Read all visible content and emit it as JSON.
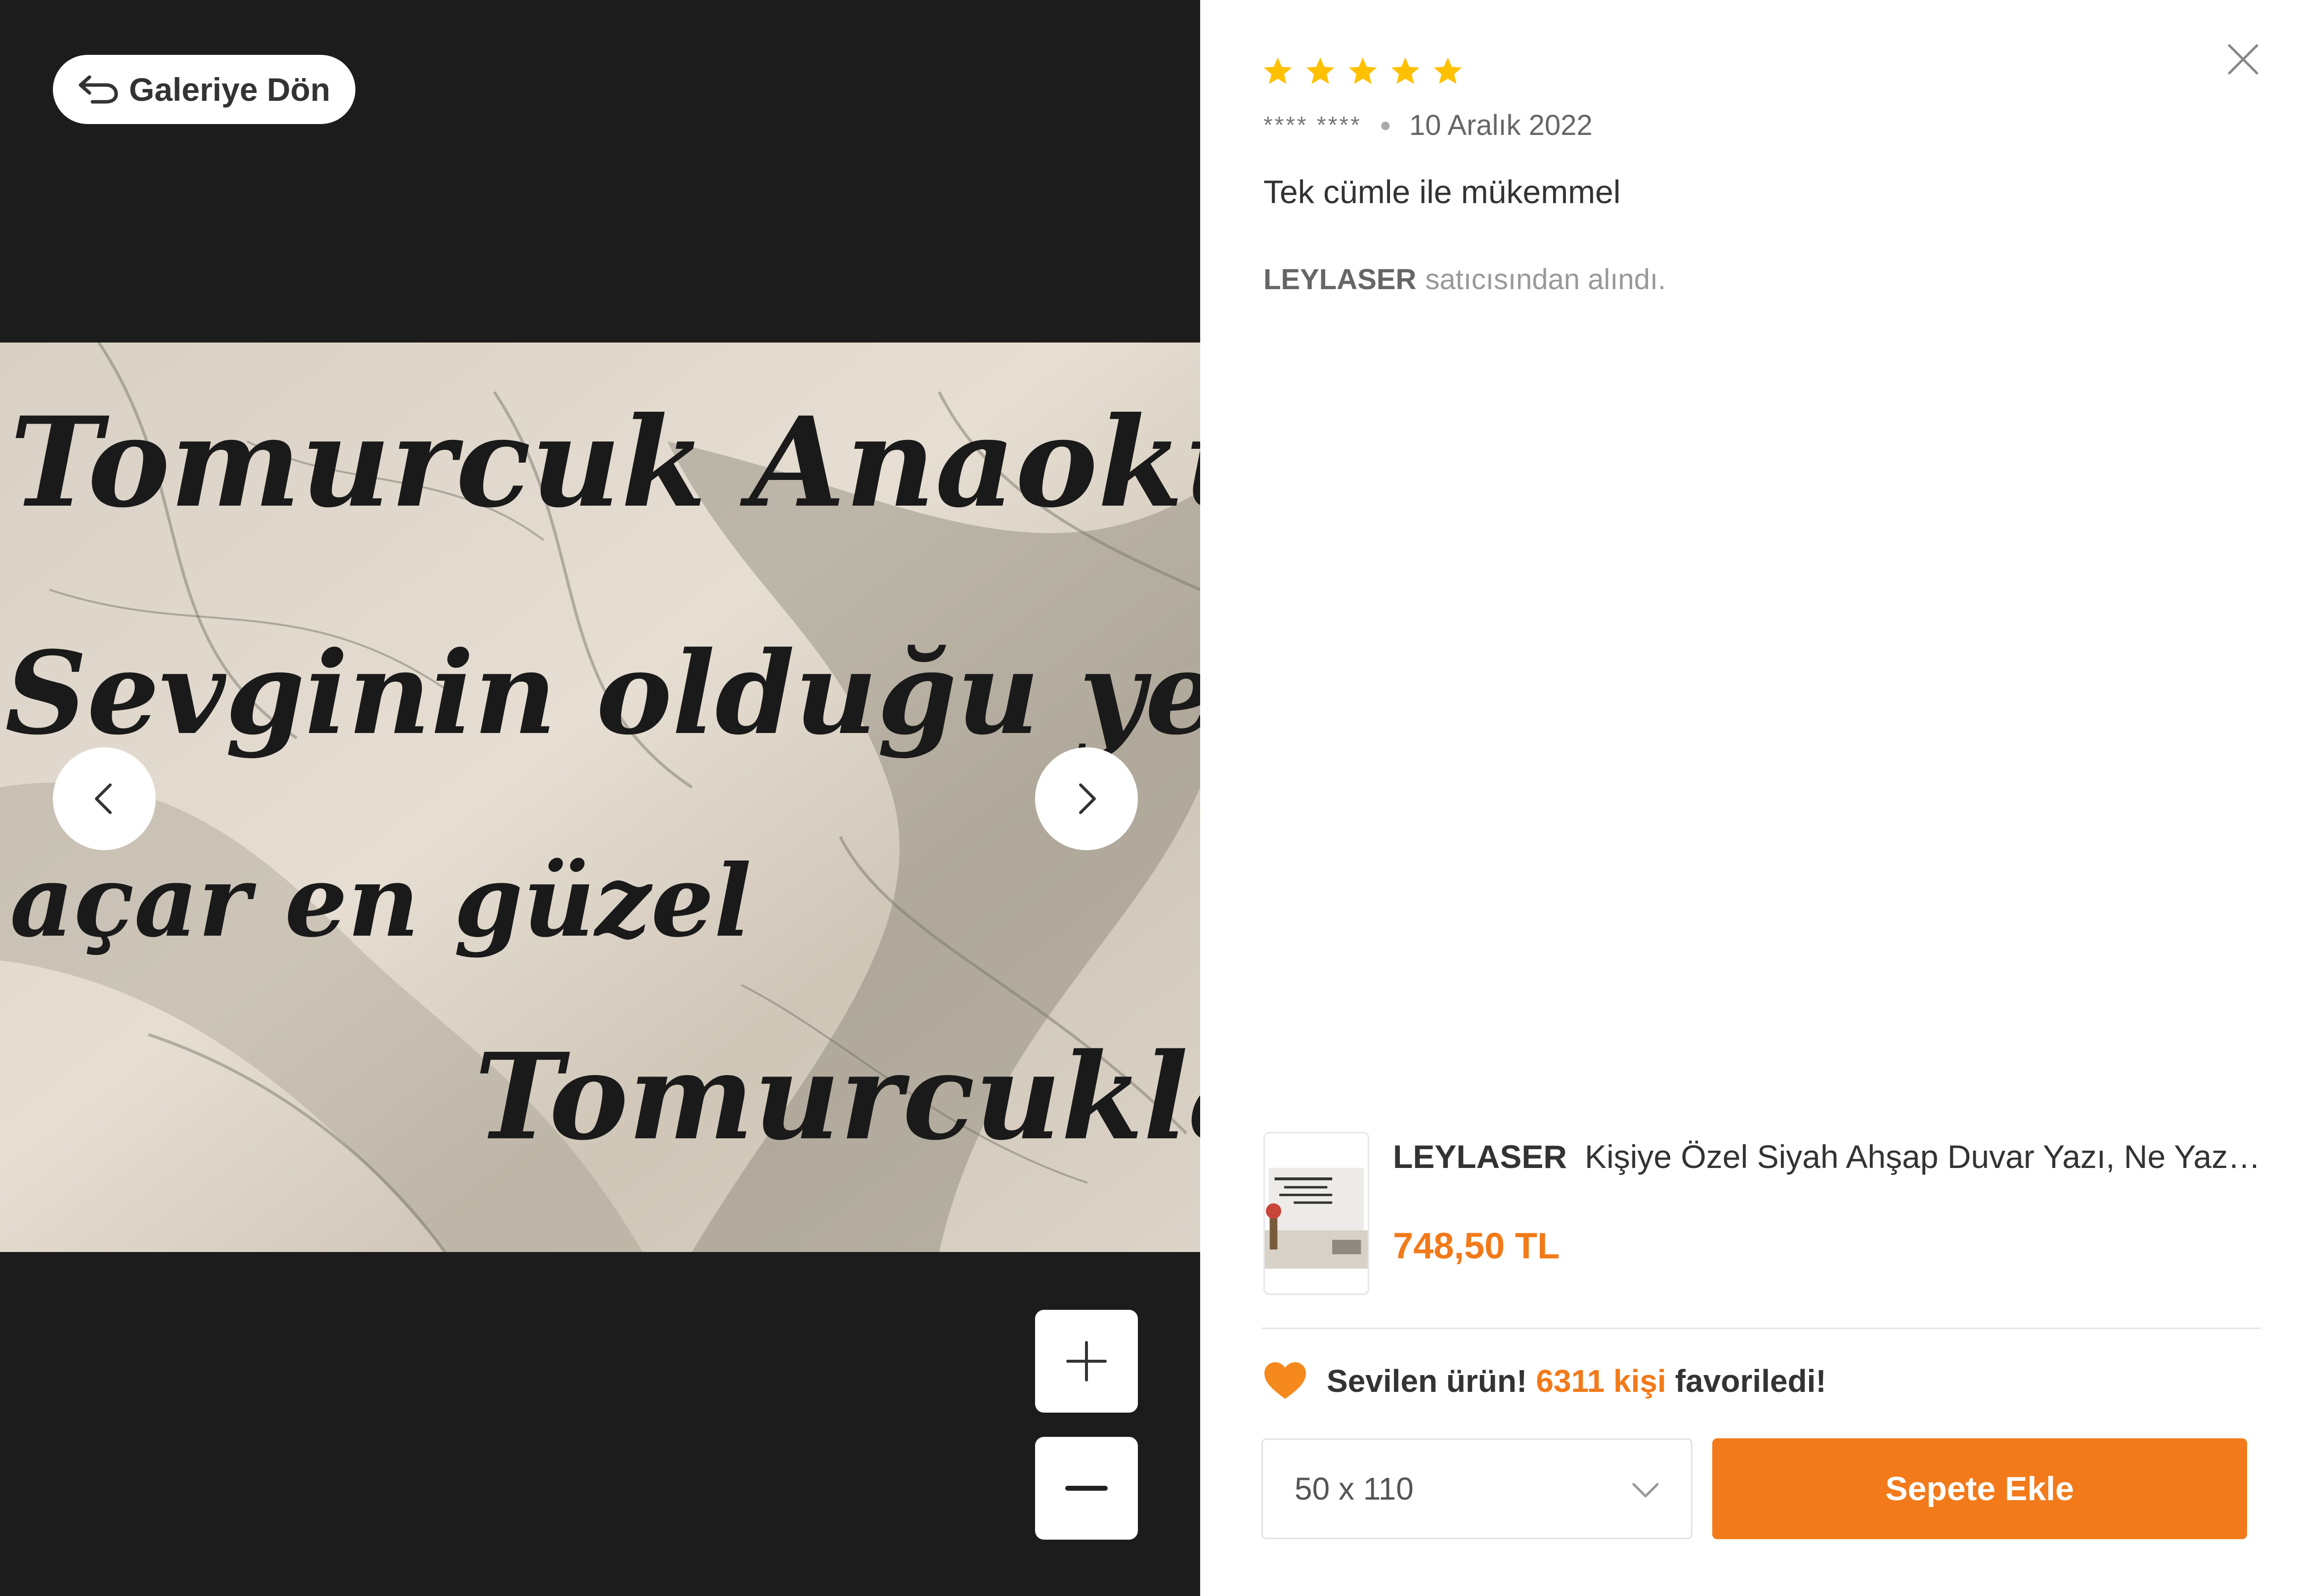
{
  "gallery": {
    "back_label": "Galeriye Dön",
    "image_text_lines": [
      "Tomurcuk Anaokulu",
      "Sevginin olduğu yerde",
      "açar en güzel",
      "Tomurcuklar"
    ]
  },
  "review": {
    "rating": 5,
    "rating_max": 5,
    "user": "**** ****",
    "date": "10 Aralık 2022",
    "comment": "Tek cümle ile mükemmel",
    "seller": "LEYLASER",
    "seller_suffix": "satıcısından alındı."
  },
  "product": {
    "brand": "LEYLASER",
    "title": "Kişiye Özel Siyah Ahşap Duvar Yazı, Ne Yazılacağını Mesaj Olarak İletiniz",
    "price": "748,50 TL"
  },
  "popularity": {
    "prefix": "Sevilen ürün!",
    "count_text": "6311 kişi",
    "suffix": "favoriledi!"
  },
  "purchase": {
    "size_value": "50 x 110",
    "add_to_cart_label": "Sepete Ekle"
  },
  "colors": {
    "accent": "#f27a1a",
    "star": "#ffc000",
    "gallery_bg": "#1c1c1c"
  },
  "icons": {
    "back": "return-arrow-icon",
    "prev": "chevron-left-icon",
    "next": "chevron-right-icon",
    "zoom_in": "plus-icon",
    "zoom_out": "minus-icon",
    "close": "close-icon",
    "heart": "orange-heart-icon",
    "dropdown": "chevron-down-icon"
  }
}
